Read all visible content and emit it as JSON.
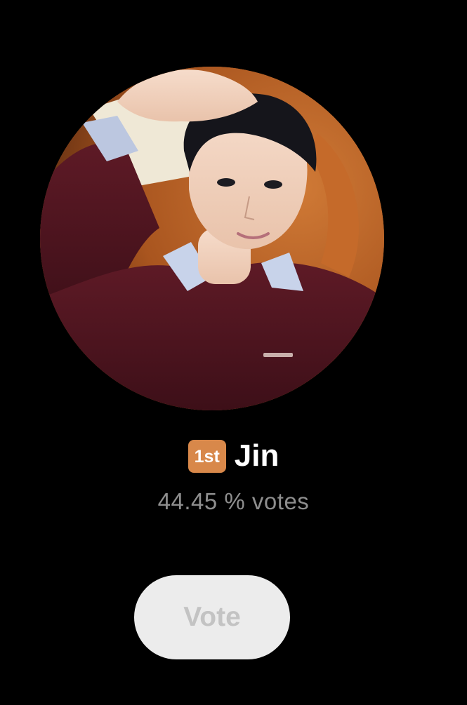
{
  "candidate": {
    "rank": "1st",
    "name": "Jin",
    "vote_percent_text": "44.45 % votes",
    "rank_badge_color": "#d8884a"
  },
  "actions": {
    "vote_label": "Vote"
  },
  "colors": {
    "background": "#000000",
    "vote_button_bg": "#ececec",
    "vote_button_text": "#c3c3c3",
    "secondary_text": "#8e8e8e"
  }
}
